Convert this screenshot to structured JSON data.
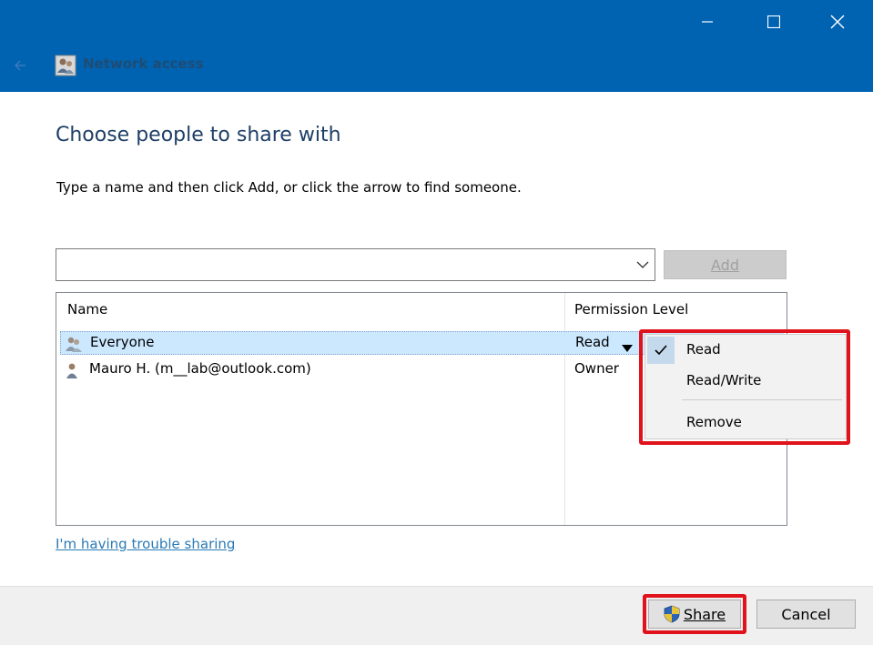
{
  "window": {
    "title": "Network access",
    "controls": [
      "minimize-icon",
      "maximize-icon",
      "close-icon"
    ],
    "back_icon": "back-arrow-icon",
    "app_icon": "network-people-icon"
  },
  "main": {
    "heading": "Choose people to share with",
    "instruction": "Type a name and then click Add, or click the arrow to find someone.",
    "name_input": {
      "value": "",
      "placeholder": ""
    },
    "add_label": "Add"
  },
  "list": {
    "columns": [
      "Name",
      "Permission Level"
    ],
    "rows": [
      {
        "name": "Everyone",
        "permission": "Read",
        "icon": "group-icon",
        "selected": true
      },
      {
        "name": "Mauro H. (m__lab@outlook.com)",
        "permission": "Owner",
        "icon": "user-icon",
        "selected": false
      }
    ]
  },
  "permission_menu": {
    "items": [
      {
        "label": "Read",
        "checked": true
      },
      {
        "label": "Read/Write",
        "checked": false
      },
      {
        "label": "Remove",
        "checked": false
      }
    ]
  },
  "links": {
    "trouble": "I'm having trouble sharing"
  },
  "footer": {
    "share_label": "Share",
    "cancel_label": "Cancel"
  },
  "colors": {
    "titlebar": "#0063b1",
    "heading": "#1e3f66",
    "link": "#2a7ab5",
    "highlight_border": "#e0121b",
    "selection": "#cce8ff"
  }
}
